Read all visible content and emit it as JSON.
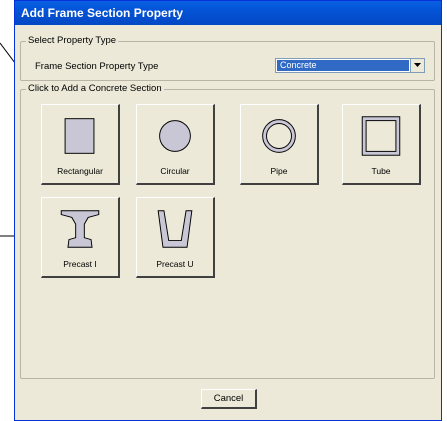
{
  "dialog": {
    "title": "Add Frame Section Property",
    "select_group": {
      "label": "Select Property Type",
      "property_label": "Frame Section Property Type",
      "property_value": "Concrete"
    },
    "sections_group": {
      "label": "Click to Add a Concrete Section",
      "buttons": [
        {
          "label": "Rectangular",
          "icon": "rectangle-section-icon"
        },
        {
          "label": "Circular",
          "icon": "circle-section-icon"
        },
        {
          "label": "Pipe",
          "icon": "pipe-section-icon"
        },
        {
          "label": "Tube",
          "icon": "tube-section-icon"
        },
        {
          "label": "Precast I",
          "icon": "precast-i-section-icon"
        },
        {
          "label": "Precast U",
          "icon": "precast-u-section-icon"
        }
      ]
    },
    "cancel_label": "Cancel"
  },
  "colors": {
    "title_bar": "#0453d6",
    "dialog_bg": "#ece9d8",
    "selection": "#316ac5",
    "shape_fill": "#c9c6d6"
  }
}
